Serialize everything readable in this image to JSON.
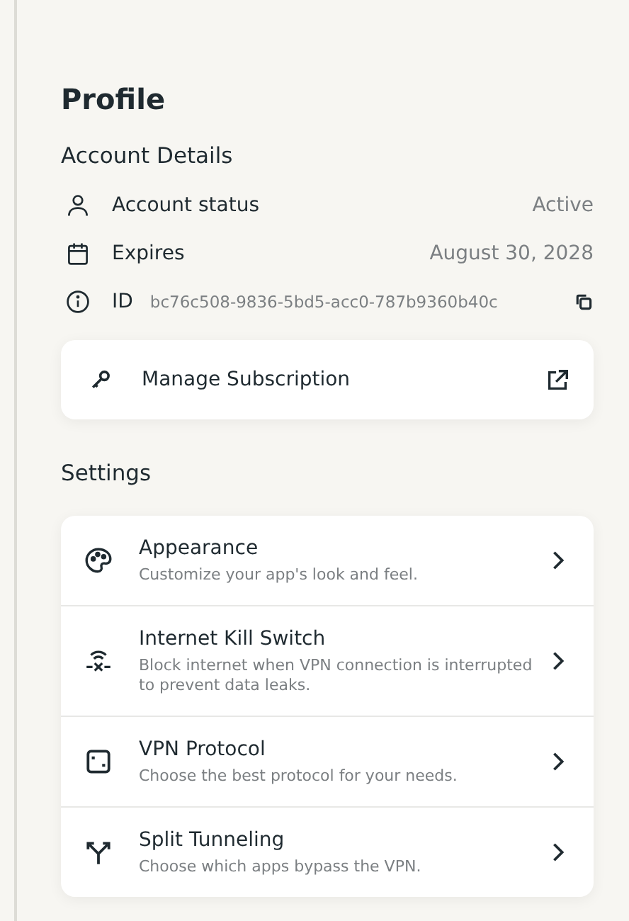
{
  "title": "Profile",
  "account": {
    "heading": "Account Details",
    "rows": [
      {
        "label": "Account status",
        "value": "Active"
      },
      {
        "label": "Expires",
        "value": "August 30, 2028"
      }
    ],
    "id": {
      "label": "ID",
      "value": "bc76c508-9836-5bd5-acc0-787b9360b40c"
    }
  },
  "manage": {
    "label": "Manage Subscription"
  },
  "settings": {
    "heading": "Settings",
    "items": [
      {
        "title": "Appearance",
        "description": "Customize your app's look and feel."
      },
      {
        "title": "Internet Kill Switch",
        "description": "Block internet when VPN connection is interrupted to prevent data leaks."
      },
      {
        "title": "VPN Protocol",
        "description": "Choose the best protocol for your needs."
      },
      {
        "title": "Split Tunneling",
        "description": "Choose which apps bypass the VPN."
      }
    ]
  }
}
